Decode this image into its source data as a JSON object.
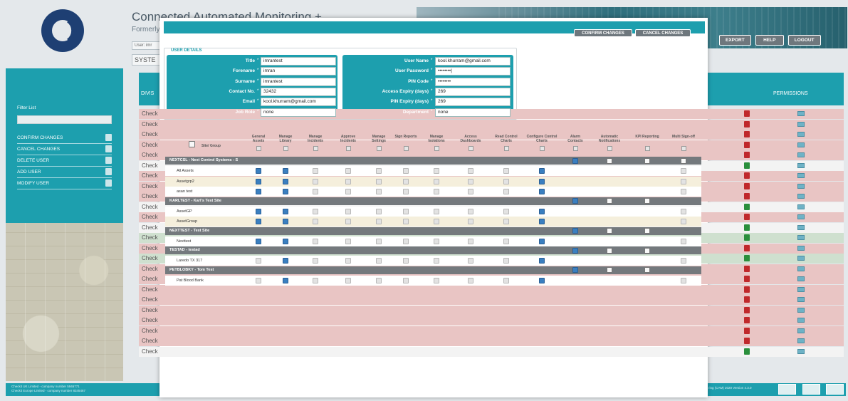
{
  "app": {
    "title": "Connected Automated Monitoring +",
    "subtitle": "Formerly",
    "user_strip": "User: imr",
    "system_label": "SYSTE",
    "top_nav": [
      "EXPORT",
      "HELP",
      "LOGOUT"
    ]
  },
  "sidebar": {
    "filter_label": "Filter List",
    "items": [
      {
        "label": "CONFIRM CHANGES",
        "icon": "save-icon"
      },
      {
        "label": "CANCEL CHANGES",
        "icon": "undo-icon"
      },
      {
        "label": "DELETE USER",
        "icon": "user-delete-icon"
      },
      {
        "label": "ADD USER",
        "icon": "user-add-icon"
      },
      {
        "label": "MODIFY USER",
        "icon": "user-edit-icon"
      }
    ]
  },
  "bg_table": {
    "division_header": "DIVIS",
    "permissions_header": "PERMISSIONS",
    "rows": [
      {
        "label": "Check",
        "color": "pink",
        "thumb": "down"
      },
      {
        "label": "Check",
        "color": "pink",
        "thumb": "down"
      },
      {
        "label": "Check",
        "color": "pink",
        "thumb": "down"
      },
      {
        "label": "Check",
        "color": "pink",
        "thumb": "down"
      },
      {
        "label": "Check",
        "color": "pink",
        "thumb": "down"
      },
      {
        "label": "Check",
        "color": "white",
        "thumb": "up"
      },
      {
        "label": "Check",
        "color": "pink",
        "thumb": "down"
      },
      {
        "label": "Check",
        "color": "pink",
        "thumb": "down"
      },
      {
        "label": "Check",
        "color": "pink",
        "thumb": "down"
      },
      {
        "label": "Check",
        "color": "white",
        "thumb": "up"
      },
      {
        "label": "Check",
        "color": "pink",
        "thumb": "down"
      },
      {
        "label": "Check",
        "color": "white",
        "thumb": "up"
      },
      {
        "label": "Check",
        "color": "green",
        "thumb": "up"
      },
      {
        "label": "Check",
        "color": "pink",
        "thumb": "down"
      },
      {
        "label": "Check",
        "color": "green",
        "thumb": "up"
      },
      {
        "label": "Check",
        "color": "pink",
        "thumb": "down"
      },
      {
        "label": "Check",
        "color": "pink",
        "thumb": "down"
      },
      {
        "label": "Check",
        "color": "pink",
        "thumb": "down"
      },
      {
        "label": "Check",
        "color": "pink",
        "thumb": "down"
      },
      {
        "label": "Check",
        "color": "pink",
        "thumb": "down"
      },
      {
        "label": "Check",
        "color": "pink",
        "thumb": "down"
      },
      {
        "label": "Check",
        "color": "pink",
        "thumb": "down"
      },
      {
        "label": "Check",
        "color": "pink",
        "thumb": "down"
      },
      {
        "label": "Check",
        "color": "white",
        "thumb": "up"
      }
    ],
    "footer_left_1": "Checkit UK Limited - company number 5946771",
    "footer_left_2": "Checkit Europe Limited - company number 8345467",
    "footer_right": "ring (CAM) 2020 Version 4.3.0"
  },
  "modal": {
    "confirm_label": "CONFIRM CHANGES",
    "cancel_label": "CANCEL CHANGES",
    "user_details_title": "USER DETAILS",
    "left_fields": [
      {
        "label": "Title",
        "value": "imrantest"
      },
      {
        "label": "Forename",
        "value": "imran"
      },
      {
        "label": "Surname",
        "value": "imrantest"
      },
      {
        "label": "Contact No.",
        "value": "32432"
      },
      {
        "label": "Email",
        "value": "kool.khurram@gmail.com"
      },
      {
        "label": "Job Role",
        "value": "none"
      }
    ],
    "right_fields": [
      {
        "label": "User Name",
        "value": "kool.khurram@gmail.com"
      },
      {
        "label": "User Password",
        "value": "••••••••|"
      },
      {
        "label": "PIN Code",
        "value": "••••••••"
      },
      {
        "label": "Access Expiry (days)",
        "value": "269"
      },
      {
        "label": "PIN Expiry (days)",
        "value": "269"
      },
      {
        "label": "Department",
        "value": "none"
      }
    ],
    "columns": [
      {
        "label": "Site/ Group",
        "is_name": true
      },
      {
        "label": "General Assets"
      },
      {
        "label": "Manage Library"
      },
      {
        "label": "Manage Incidents"
      },
      {
        "label": "Approve Incidents"
      },
      {
        "label": "Manage Settings"
      },
      {
        "label": "Sign Reports"
      },
      {
        "label": "Manage Isolations"
      },
      {
        "label": "Access Dashboards"
      },
      {
        "label": "Read Control Charts"
      },
      {
        "label": "Configure Control Charts"
      },
      {
        "label": "Alarm Contacts"
      },
      {
        "label": "Automatic Notifications"
      },
      {
        "label": "KPI Reporting"
      },
      {
        "label": "Multi Sign-off"
      }
    ],
    "groups": [
      {
        "label": "NEXTCSL - Next Control Systems - S",
        "group_checks": [
          11,
          12,
          13,
          14
        ],
        "group_checked": [
          11
        ],
        "items": [
          {
            "label": "All Assets",
            "on": [
              1,
              2,
              10
            ]
          },
          {
            "label": "Assetgrp2",
            "on": [
              1,
              2,
              10
            ]
          },
          {
            "label": "asan test",
            "on": [
              1,
              2,
              10
            ]
          }
        ]
      },
      {
        "label": "KARLTEST - Karl's Test Site",
        "group_checks": [
          11,
          12,
          13
        ],
        "group_checked": [
          11
        ],
        "items": [
          {
            "label": "AssetGP",
            "on": [
              1,
              2,
              10
            ]
          },
          {
            "label": "AssetGroup",
            "on": [
              1,
              2,
              10
            ]
          }
        ]
      },
      {
        "label": "NEXTTEST - Test Site",
        "group_checks": [
          11,
          12,
          13
        ],
        "group_checked": [
          11
        ],
        "items": [
          {
            "label": "Nexttest",
            "on": [
              1,
              2,
              10
            ]
          }
        ]
      },
      {
        "label": "TESTAD - testad",
        "group_checks": [
          11,
          12,
          13
        ],
        "group_checked": [
          11
        ],
        "items": [
          {
            "label": "Laredo TX 317",
            "on": [
              2,
              10
            ]
          }
        ]
      },
      {
        "label": "PETBLOBKY - Tom Test",
        "group_checks": [
          11,
          12,
          13
        ],
        "group_checked": [
          11
        ],
        "items": [
          {
            "label": "Pat Blood Bank",
            "on": [
              2,
              10
            ]
          }
        ]
      }
    ]
  },
  "colors": {
    "teal": "#1d9fae",
    "group_row": "#74797d",
    "checked": "#3a7fc0",
    "row_alt": "#f5efdc"
  }
}
